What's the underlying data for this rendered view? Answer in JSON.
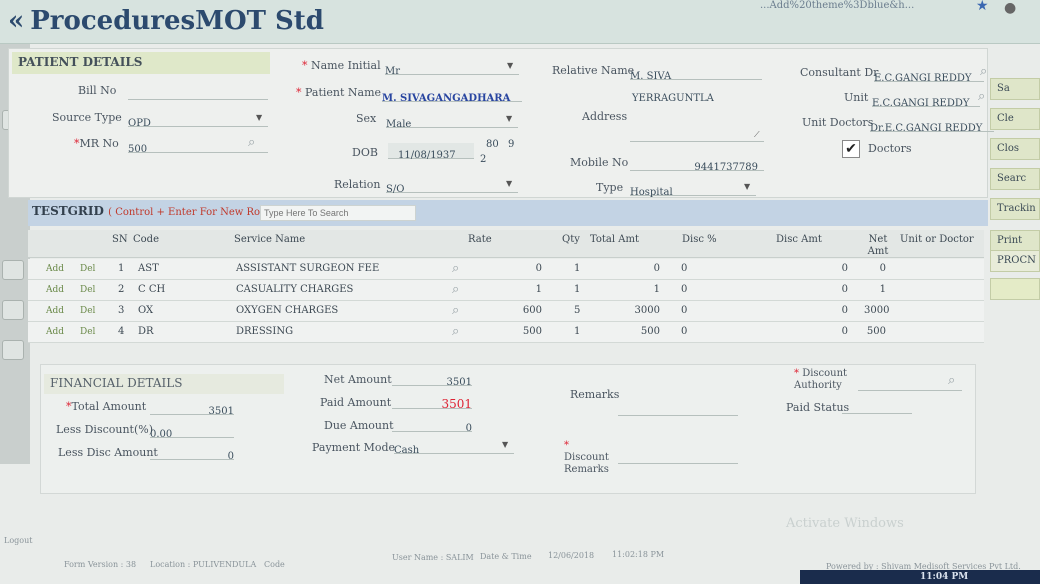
{
  "header": {
    "url_fragment": "...Add%20theme%3Dblue&h...",
    "title": "ProceduresMOT Std"
  },
  "patient": {
    "section_title": "PATIENT DETAILS",
    "bill_no_label": "Bill No",
    "source_type_label": "Source Type",
    "source_type": "OPD",
    "mr_no_label": "MR No",
    "mr_no": "500",
    "name_initial_label": "Name Initial",
    "name_initial": "Mr",
    "patient_name_label": "Patient Name",
    "patient_name": "M. SIVAGANGADHARA",
    "sex_label": "Sex",
    "sex": "Male",
    "dob_label": "DOB",
    "dob": "11/08/1937",
    "age_years": "80",
    "age_months": "9",
    "age_days": "2",
    "relation_label": "Relation",
    "relation": "S/O",
    "relative_name_label": "Relative Name",
    "relative_name": "M. SIVA",
    "address_line1": "YERRAGUNTLA",
    "address_label": "Address",
    "mobile_label": "Mobile No",
    "mobile": "9441737789",
    "type_label": "Type",
    "type": "Hospital",
    "consultant_label": "Consultant Dr",
    "consultant": "E.C.GANGI REDDY",
    "unit_label": "Unit",
    "unit": "E.C.GANGI REDDY",
    "unit_doctors_label": "Unit Doctors",
    "unit_doctors": "Dr.E.C.GANGI REDDY",
    "doctors_label": "Doctors",
    "doctors_checked": true
  },
  "right_buttons": [
    "Sa",
    "Cle",
    "Clos",
    "Searc",
    "Trackin",
    "Print",
    "PROCN"
  ],
  "grid": {
    "title": "TESTGRID",
    "hint": "( Control + Enter For New Row )",
    "search_placeholder": "Type Here To Search",
    "columns": [
      "SN",
      "Code",
      "Service Name",
      "Rate",
      "Qty",
      "Total Amt",
      "Disc %",
      "Disc Amt",
      "Net Amt",
      "Unit or Doctor"
    ],
    "add_label": "Add",
    "del_label": "Del",
    "rows": [
      {
        "sn": "1",
        "code": "AST",
        "service": "ASSISTANT SURGEON FEE",
        "rate": "0",
        "qty": "1",
        "total": "0",
        "disc_pct": "0",
        "disc_amt": "0",
        "net": "0"
      },
      {
        "sn": "2",
        "code": "C CH",
        "service": "CASUALITY CHARGES",
        "rate": "1",
        "qty": "1",
        "total": "1",
        "disc_pct": "0",
        "disc_amt": "0",
        "net": "1"
      },
      {
        "sn": "3",
        "code": "OX",
        "service": "OXYGEN CHARGES",
        "rate": "600",
        "qty": "5",
        "total": "3000",
        "disc_pct": "0",
        "disc_amt": "0",
        "net": "3000"
      },
      {
        "sn": "4",
        "code": "DR",
        "service": "DRESSING",
        "rate": "500",
        "qty": "1",
        "total": "500",
        "disc_pct": "0",
        "disc_amt": "0",
        "net": "500"
      }
    ]
  },
  "financial": {
    "section_title": "FINANCIAL DETAILS",
    "total_amount_label": "Total Amount",
    "total_amount": "3501",
    "less_discount_label": "Less Discount(%)",
    "less_discount": "0.00",
    "less_disc_amount_label": "Less Disc Amount",
    "less_disc_amount": "0",
    "net_amount_label": "Net Amount",
    "net_amount": "3501",
    "paid_amount_label": "Paid Amount",
    "paid_amount": "3501",
    "due_amount_label": "Due Amount",
    "due_amount": "0",
    "payment_mode_label": "Payment Mode",
    "payment_mode": "Cash",
    "remarks_label": "Remarks",
    "discount_remarks_label": "Discount Remarks",
    "discount_authority_label": "Discount Authority",
    "paid_status_label": "Paid Status"
  },
  "footer": {
    "logout": "Logout",
    "form_version_label": "Form Version",
    "form_version": "38",
    "location_label": "Location",
    "location": "PULIVENDULA",
    "code_label": "Code",
    "user_label": "User Name",
    "user": "SALIM",
    "datetime_label": "Date & Time",
    "date": "12/06/2018",
    "time": "11:02:18 PM",
    "powered_by": "Powered by : Shivam Medisoft Services Pvt Ltd.",
    "activate": "Activate Windows",
    "clock": "11:04 PM"
  },
  "colors": {
    "accent": "#2c4a6e",
    "required": "#dd2233",
    "header_green": "#dfe8c9",
    "grid_blue": "#c3d3e4"
  }
}
